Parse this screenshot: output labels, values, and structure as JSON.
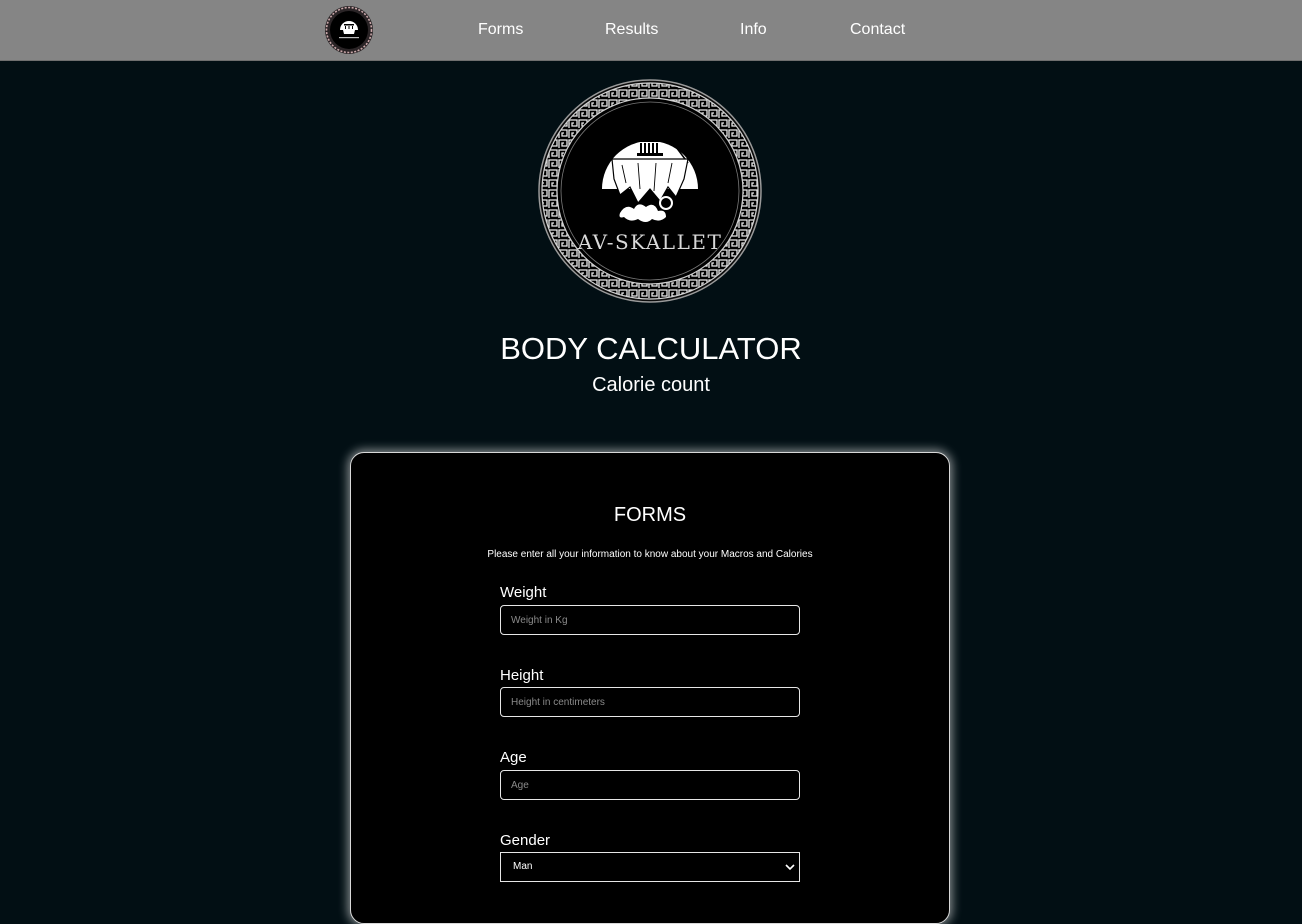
{
  "nav": {
    "logo": "av-skallet-logo",
    "links": [
      "Forms",
      "Results",
      "Info",
      "Contact"
    ]
  },
  "hero": {
    "logo_text": "AV-SKALLET",
    "title": "BODY CALCULATOR",
    "subtitle": "Calorie count"
  },
  "form": {
    "title": "FORMS",
    "description": "Please enter all your information to know about your Macros and Calories",
    "fields": [
      {
        "label": "Weight",
        "placeholder": "Weight in Kg",
        "value": ""
      },
      {
        "label": "Height",
        "placeholder": "Height in centimeters",
        "value": ""
      },
      {
        "label": "Age",
        "placeholder": "Age",
        "value": ""
      }
    ],
    "gender": {
      "label": "Gender",
      "selected": "Man"
    }
  },
  "colors": {
    "navbar": "#858585",
    "page_background": "#020f14",
    "card_background": "#000000",
    "text": "#ffffff"
  }
}
